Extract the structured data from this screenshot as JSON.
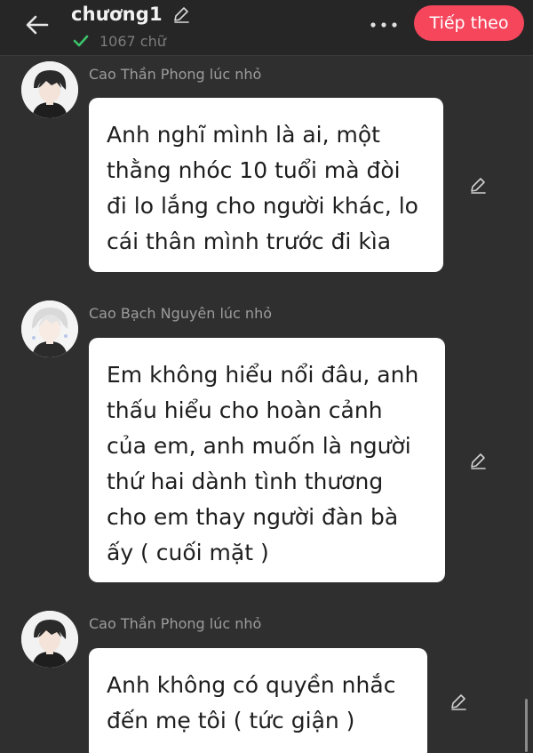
{
  "header": {
    "title": "chương1",
    "word_count": "1067 chữ",
    "next_label": "Tiếp theo",
    "icons": {
      "back": "arrow-left-icon",
      "edit_title": "pencil-icon",
      "status": "check-icon",
      "more": "more-dots-icon"
    }
  },
  "colors": {
    "background": "#2f2f2f",
    "header_bg": "#262626",
    "accent": "#f5465c",
    "check": "#3cc46b",
    "bubble": "#ffffff"
  },
  "messages": [
    {
      "sender": "Cao Thần Phong lúc nhỏ",
      "text": "Anh nghĩ mình là ai, một\nthằng nhóc 10 tuổi mà đòi\nđi lo lắng cho người khác, lo\ncái thân mình trước đi kìa",
      "edit_icon": "pencil-icon"
    },
    {
      "sender": "Cao Bạch Nguyên lúc nhỏ",
      "text": "Em không hiểu nổi đâu, anh\nthấu hiểu cho hoàn cảnh\ncủa em, anh muốn là người\nthứ hai dành tình thương\ncho em thay người đàn bà\nấy ( cuối mặt )",
      "edit_icon": "pencil-icon"
    },
    {
      "sender": "Cao Thần Phong lúc nhỏ",
      "text": "Anh không có quyền nhắc\nđến mẹ tôi ( tức giận )",
      "edit_icon": "pencil-icon"
    }
  ]
}
